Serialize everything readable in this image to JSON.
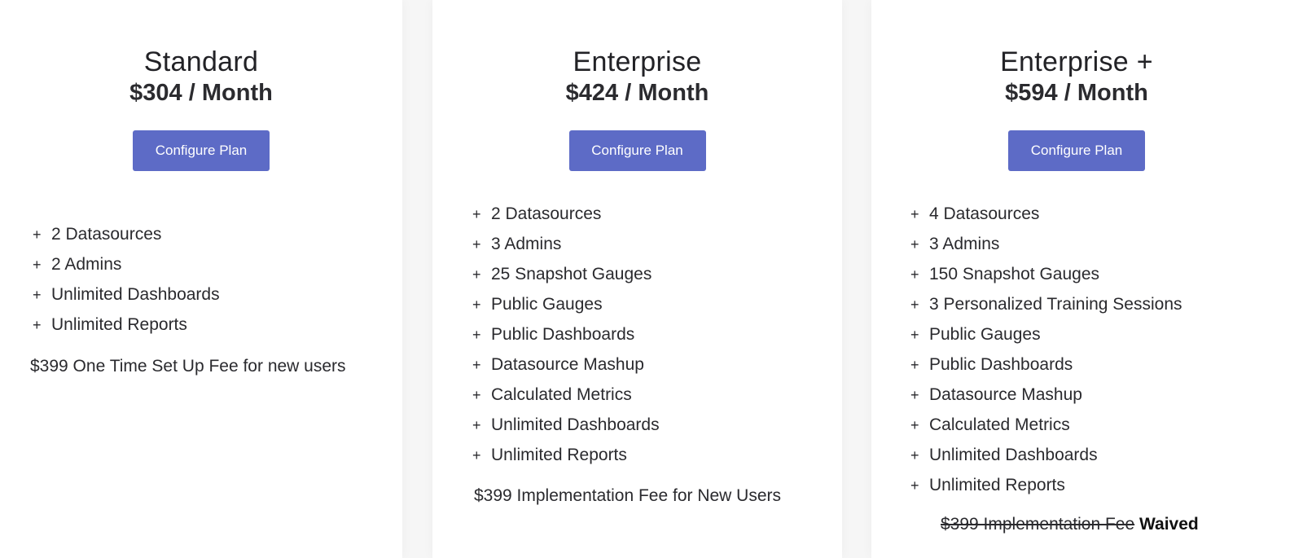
{
  "plans": [
    {
      "name": "Standard",
      "price": "$304 / Month",
      "button_label": "Configure Plan",
      "features": [
        "2 Datasources",
        "2 Admins",
        "Unlimited Dashboards",
        "Unlimited Reports"
      ],
      "feature_icon": "plus-icon",
      "fee_note": "$399 One Time Set Up Fee for new users"
    },
    {
      "name": "Enterprise",
      "price": "$424 / Month",
      "button_label": "Configure Plan",
      "features": [
        "2 Datasources",
        "3 Admins",
        "25 Snapshot Gauges",
        "Public Gauges",
        "Public Dashboards",
        "Datasource Mashup",
        "Calculated Metrics",
        "Unlimited Dashboards",
        "Unlimited Reports"
      ],
      "feature_icon": "plus-icon",
      "fee_note": "$399 Implementation Fee for New Users"
    },
    {
      "name": "Enterprise +",
      "price": "$594 / Month",
      "button_label": "Configure Plan",
      "features": [
        "4 Datasources",
        "3 Admins",
        "150 Snapshot Gauges",
        "3 Personalized Training Sessions",
        "Public Gauges",
        "Public Dashboards",
        "Datasource Mashup",
        "Calculated Metrics",
        "Unlimited Dashboards",
        "Unlimited Reports"
      ],
      "feature_icon": "plus-icon",
      "fee_note_struck": "$399 Implementation Fee",
      "fee_note_status": "Waived"
    }
  ],
  "plus_glyph": "+",
  "colors": {
    "button": "#5d6bc6",
    "button_text": "#ffffff",
    "background_gap": "#f6f6f6",
    "card": "#ffffff"
  }
}
